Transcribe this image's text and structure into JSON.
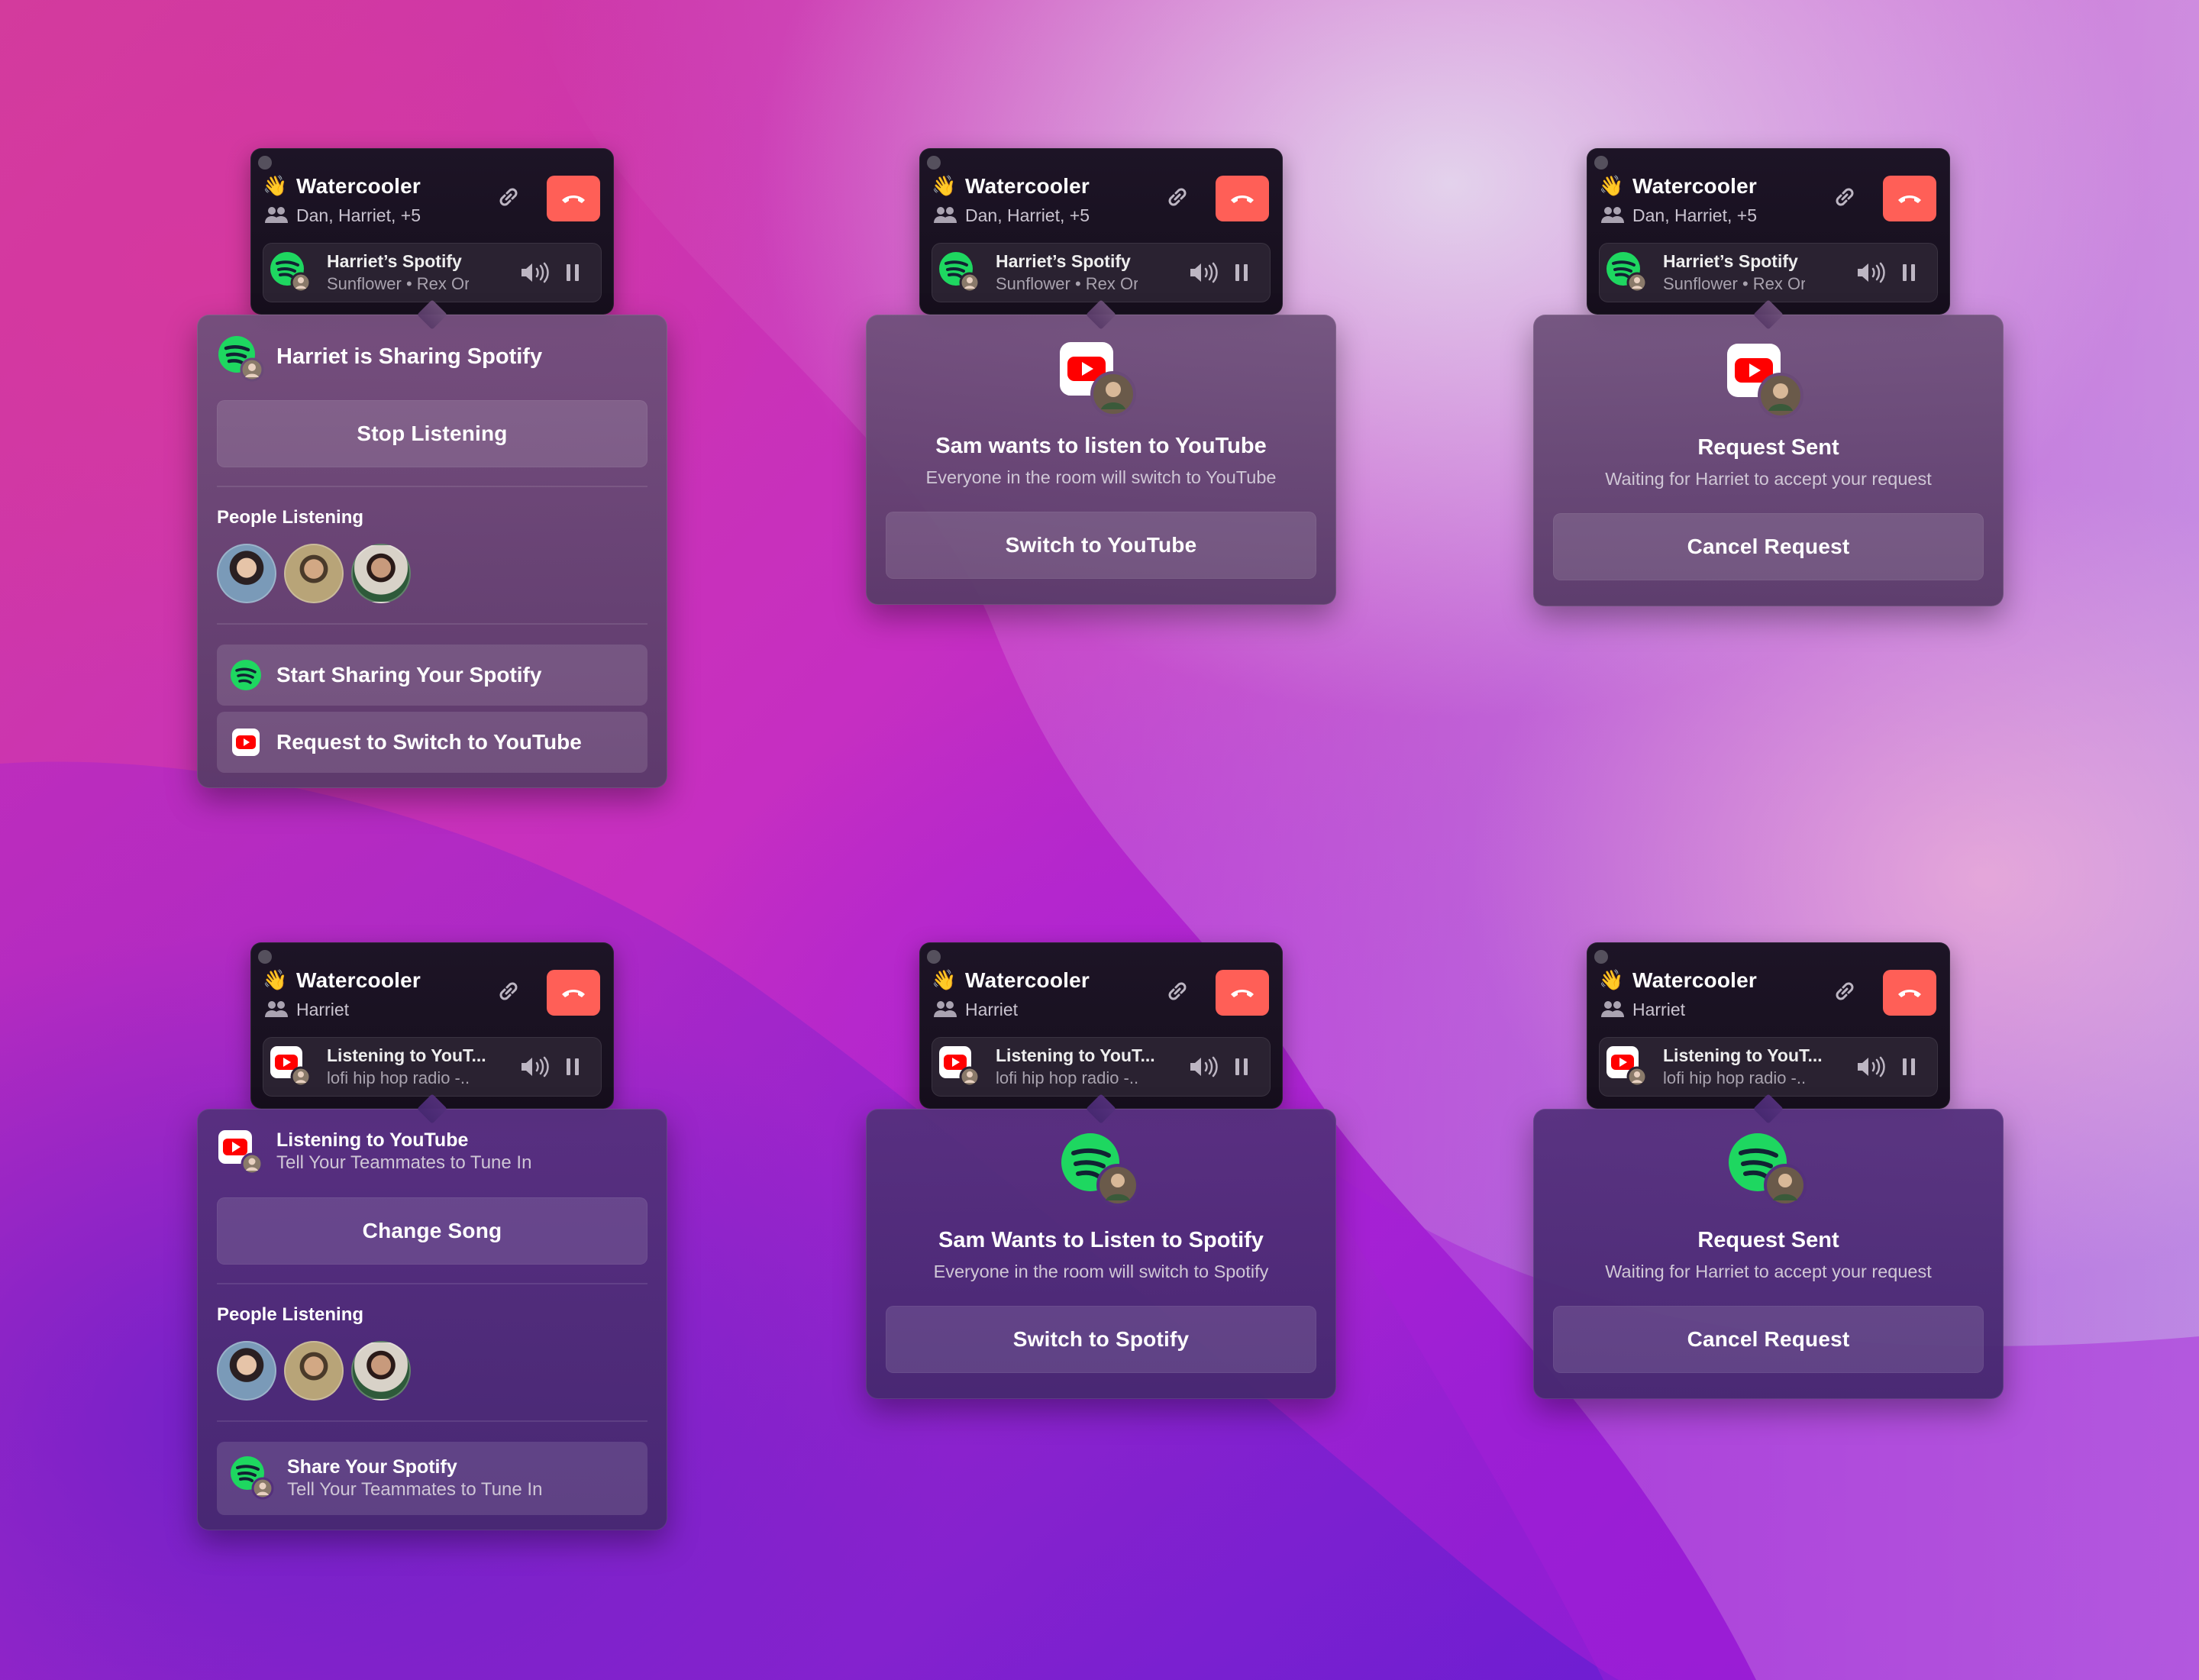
{
  "colors": {
    "hangup": "#ff5f57",
    "spotify": "#1ed760",
    "youtube": "#ff0000",
    "pill_bg": "#1a1222",
    "panel_bg": "#6a4a78"
  },
  "widgets": [
    {
      "room_title": "Watercooler",
      "room_emoji": "👋",
      "people": "Dan, Harriet, +5",
      "player_app": "spotify",
      "player_title": "Harriet’s Spotify",
      "player_subtitle": "Sunflower • Rex Orange County",
      "panel": {
        "header_title": "Harriet is Sharing Spotify",
        "primary_button": "Stop Listening",
        "section_label": "People Listening",
        "row1_label": "Start Sharing Your Spotify",
        "row2_label": "Request to Switch to YouTube"
      }
    },
    {
      "room_title": "Watercooler",
      "room_emoji": "👋",
      "people": "Dan, Harriet, +5",
      "player_app": "spotify",
      "player_title": "Harriet’s Spotify",
      "player_subtitle": "Sunflower • Rex Orange County",
      "panel": {
        "title": "Sam wants to listen to YouTube",
        "subtitle": "Everyone in the room will switch to YouTube",
        "button": "Switch to YouTube"
      }
    },
    {
      "room_title": "Watercooler",
      "room_emoji": "👋",
      "people": "Dan, Harriet, +5",
      "player_app": "spotify",
      "player_title": "Harriet’s Spotify",
      "player_subtitle": "Sunflower • Rex Orange County",
      "panel": {
        "title": "Request Sent",
        "subtitle": "Waiting for Harriet to accept your request",
        "button": "Cancel Request"
      }
    },
    {
      "room_title": "Watercooler",
      "room_emoji": "👋",
      "people": "Harriet",
      "player_app": "youtube",
      "player_title": "Listening to YouT...",
      "player_subtitle": "lofi hip hop radio -...",
      "panel": {
        "header_title": "Listening to YouTube",
        "header_subtitle": "Tell Your Teammates to Tune In",
        "primary_button": "Change Song",
        "section_label": "People Listening",
        "row_title": "Share Your Spotify",
        "row_subtitle": "Tell Your Teammates to Tune In"
      }
    },
    {
      "room_title": "Watercooler",
      "room_emoji": "👋",
      "people": "Harriet",
      "player_app": "youtube",
      "player_title": "Listening to YouT...",
      "player_subtitle": "lofi hip hop radio -...",
      "panel": {
        "title": "Sam Wants to Listen to Spotify",
        "subtitle": "Everyone in the room will switch to Spotify",
        "button": "Switch to Spotify"
      }
    },
    {
      "room_title": "Watercooler",
      "room_emoji": "👋",
      "people": "Harriet",
      "player_app": "youtube",
      "player_title": "Listening to YouT...",
      "player_subtitle": "lofi hip hop radio -...",
      "panel": {
        "title": "Request Sent",
        "subtitle": "Waiting for Harriet to accept your request",
        "button": "Cancel Request"
      }
    }
  ]
}
